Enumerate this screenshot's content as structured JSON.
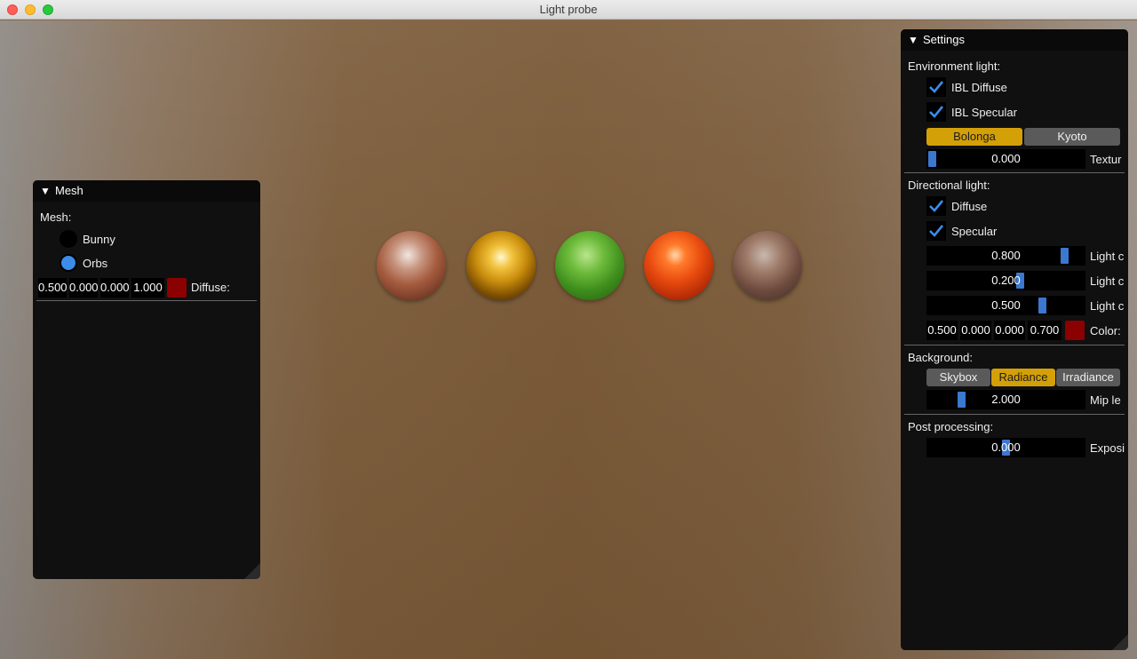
{
  "window": {
    "title": "Light probe"
  },
  "mesh_panel": {
    "title": "Mesh",
    "section_label": "Mesh:",
    "options": [
      {
        "label": "Bunny",
        "selected": false
      },
      {
        "label": "Orbs",
        "selected": true
      }
    ],
    "diffuse": {
      "values": [
        "0.500",
        "0.000",
        "0.000",
        "1.000"
      ],
      "label": "Diffuse:",
      "swatch_color": "#8b0000"
    }
  },
  "settings_panel": {
    "title": "Settings",
    "environment": {
      "label": "Environment light:",
      "ibl_diffuse": {
        "label": "IBL Diffuse",
        "checked": true
      },
      "ibl_specular": {
        "label": "IBL Specular",
        "checked": true
      },
      "maps": [
        {
          "label": "Bolonga",
          "active": true
        },
        {
          "label": "Kyoto",
          "active": false
        }
      ],
      "texture_slider": {
        "value": "0.000",
        "label": "Textur"
      }
    },
    "directional": {
      "label": "Directional light:",
      "diffuse": {
        "label": "Diffuse",
        "checked": true
      },
      "specular": {
        "label": "Specular",
        "checked": true
      },
      "sliders": [
        {
          "value": "0.800",
          "label": "Light c"
        },
        {
          "value": "0.200",
          "label": "Light c"
        },
        {
          "value": "0.500",
          "label": "Light c"
        }
      ],
      "color": {
        "values": [
          "0.500",
          "0.000",
          "0.000",
          "0.700"
        ],
        "label": "Color:",
        "swatch_color": "#8b0000"
      }
    },
    "background": {
      "label": "Background:",
      "modes": [
        {
          "label": "Skybox",
          "active": false
        },
        {
          "label": "Radiance",
          "active": true
        },
        {
          "label": "Irradiance",
          "active": false
        }
      ],
      "mip_slider": {
        "value": "2.000",
        "label": "Mip le"
      }
    },
    "post": {
      "label": "Post processing:",
      "exposure_slider": {
        "value": "0.000",
        "label": "Exposi"
      }
    }
  },
  "colors": {
    "accent": "#3b78d0",
    "active_button": "#d4a008",
    "panel_bg": "#101010"
  },
  "icons": {
    "collapse": "triangle-down-icon",
    "check": "checkmark-icon"
  }
}
